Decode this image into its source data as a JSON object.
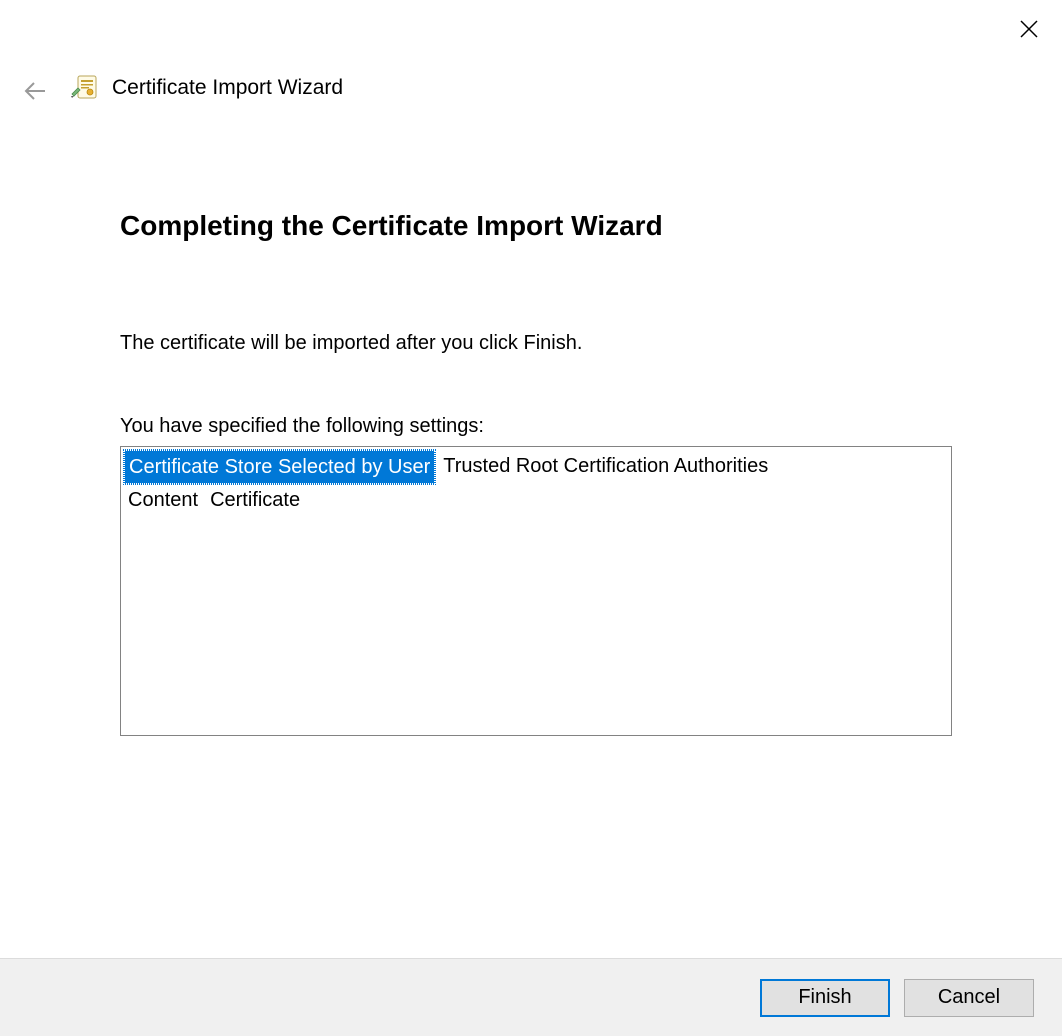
{
  "header": {
    "wizard_title": "Certificate Import Wizard"
  },
  "page": {
    "heading": "Completing the Certificate Import Wizard",
    "description": "The certificate will be imported after you click Finish.",
    "settings_label": "You have specified the following settings:"
  },
  "settings": [
    {
      "name": "Certificate Store Selected by User",
      "value": "Trusted Root Certification Authorities",
      "selected": true
    },
    {
      "name": "Content",
      "value": "Certificate",
      "selected": false
    }
  ],
  "buttons": {
    "finish": "Finish",
    "cancel": "Cancel"
  }
}
